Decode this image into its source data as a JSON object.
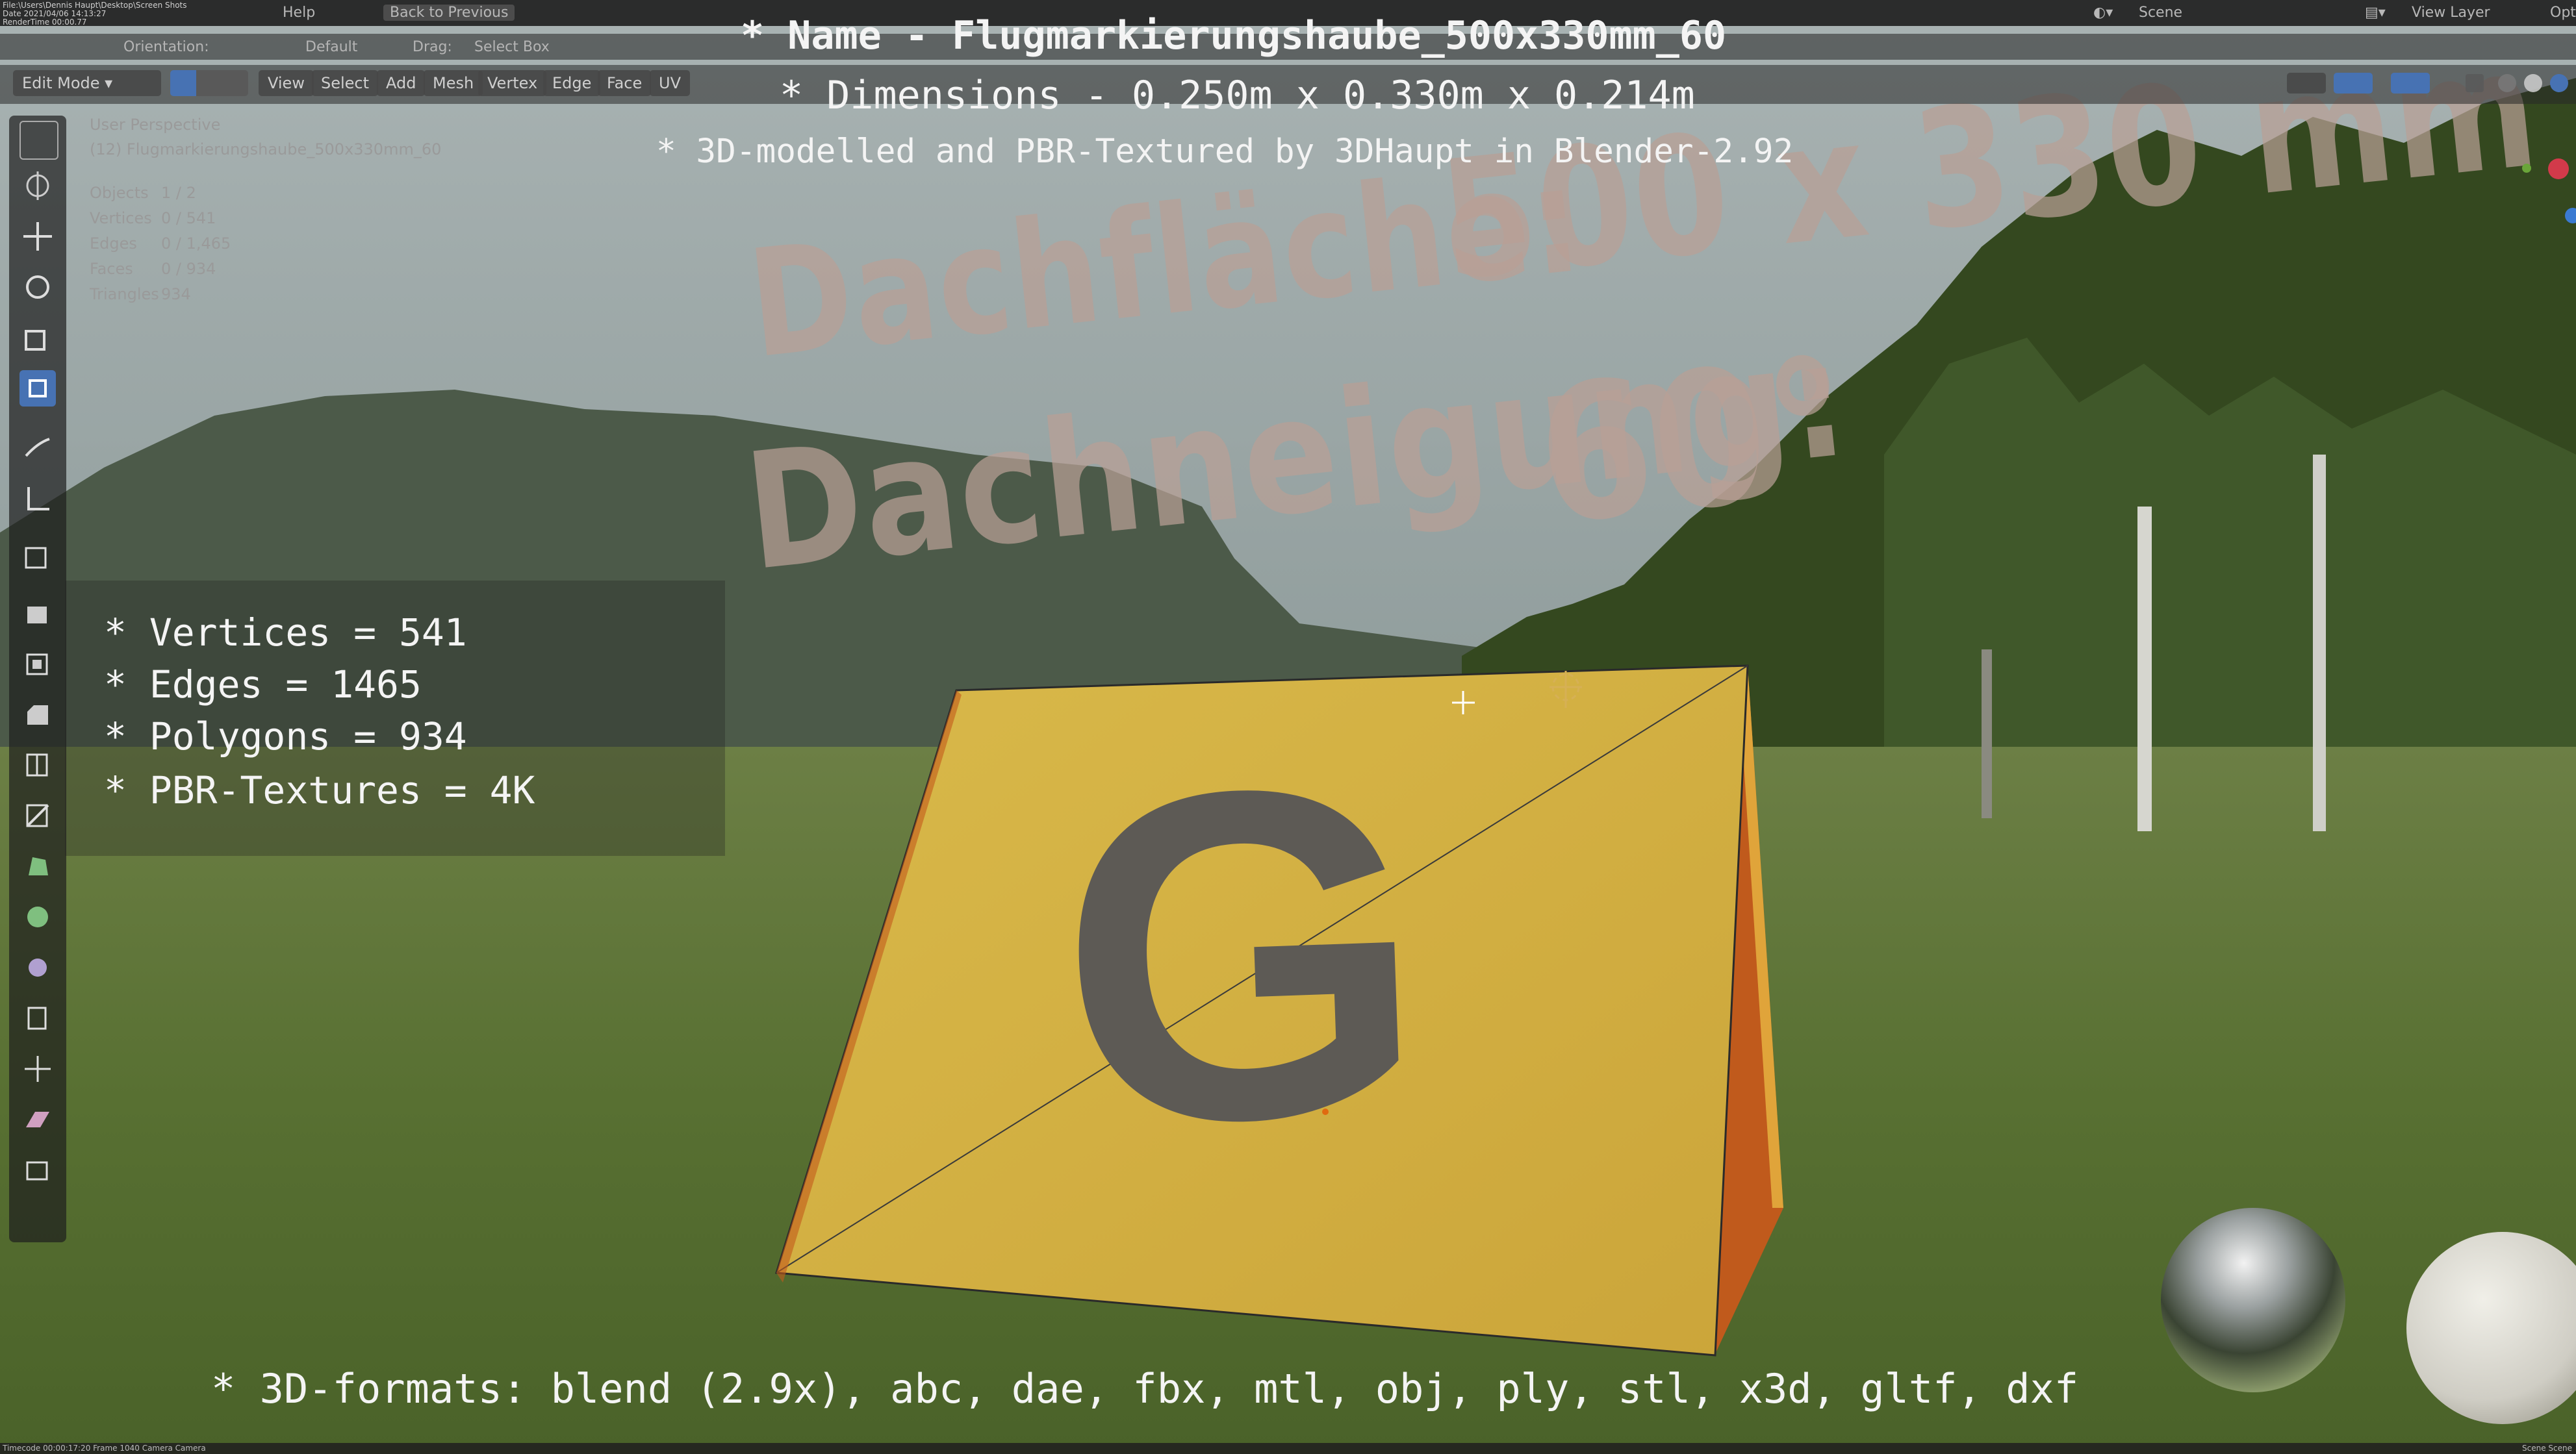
{
  "app": {
    "menu_help": "Help",
    "back_to_previous": "Back to Previous",
    "scene": "Scene",
    "view_layer": "View Layer",
    "opt_partial": "Opt",
    "file_info": "File:\\Users\\Dennis Haupt\\Desktop\\Screen Shots",
    "date_info": "Date 2021/04/06 14:13:27",
    "render_time": "RenderTime 00:00.77"
  },
  "toolbar_header": {
    "orientation": "Orientation:",
    "orientation_value": "Default",
    "drag_label": "Drag:",
    "drag_value": "Select Box"
  },
  "viewport_header": {
    "mode": "Edit Mode",
    "menus": [
      "View",
      "Select",
      "Add",
      "Mesh",
      "Vertex",
      "Edge",
      "Face",
      "UV"
    ]
  },
  "viewport_info": {
    "perspective": "User Perspective",
    "object_name": "(12) Flugmarkierungshaube_500x330mm_60",
    "stats": [
      {
        "label": "Objects",
        "value": "1 / 2"
      },
      {
        "label": "Vertices",
        "value": "0 / 541"
      },
      {
        "label": "Edges",
        "value": "0 / 1,465"
      },
      {
        "label": "Faces",
        "value": "0 / 934"
      },
      {
        "label": "Triangles",
        "value": "934"
      }
    ]
  },
  "overlay": {
    "name_line": "* Name - Flugmarkierungshaube_500x330mm_60",
    "dimensions_line": "* Dimensions -  0.250m x 0.330m x 0.214m",
    "credit_line": "* 3D-modelled and PBR-Textured by 3DHaupt in Blender-2.92",
    "stats": [
      "* Vertices = 541",
      "* Edges = 1465",
      "* Polygons = 934",
      "* PBR-Textures = 4K"
    ],
    "formats_line": "* 3D-formats: blend (2.9x), abc, dae, fbx, mtl, obj, ply, stl, x3d, gltf, dxf"
  },
  "text_layer": {
    "line1_label": "Dachfläche:",
    "line1_value": "500 x 330 mm",
    "line2_label": "Dachneigung:",
    "line2_value": "60°"
  },
  "marker": {
    "letter": "G"
  },
  "statusbar": {
    "left": "Timecode 00:00:17:20   Frame 1040   Camera Camera",
    "right": "Scene Scene"
  },
  "colors": {
    "sky": "#9aa7a9",
    "grass": "#5b7035",
    "panel_yellow": "#d8b640",
    "panel_side": "#c05a1c",
    "letter_gray": "#5d5a55",
    "active_tool": "#4772b3"
  },
  "tools": [
    "select-box",
    "cursor",
    "move",
    "rotate",
    "scale",
    "transform",
    "annotate",
    "measure",
    "add-cube",
    "extrude-region",
    "inset-faces",
    "bevel",
    "loop-cut",
    "knife",
    "poly-build",
    "spin",
    "smooth",
    "edge-slide",
    "shrink-fatten",
    "shear",
    "rip-region"
  ]
}
